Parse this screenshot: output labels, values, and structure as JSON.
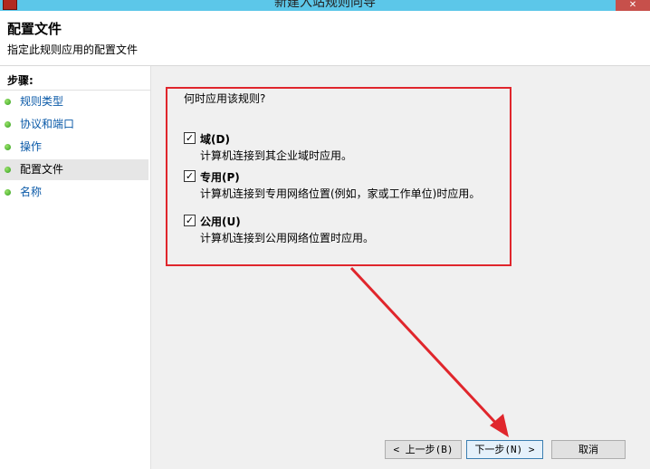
{
  "window": {
    "title": "新建入站规则向导",
    "close_label": "✕"
  },
  "header": {
    "title": "配置文件",
    "subtitle": "指定此规则应用的配置文件"
  },
  "steps": {
    "title": "步骤:",
    "items": [
      {
        "label": "规则类型",
        "current": false
      },
      {
        "label": "协议和端口",
        "current": false
      },
      {
        "label": "操作",
        "current": false
      },
      {
        "label": "配置文件",
        "current": true
      },
      {
        "label": "名称",
        "current": false
      }
    ]
  },
  "main": {
    "question": "何时应用该规则?",
    "options": [
      {
        "label": "域(D)",
        "description": "计算机连接到其企业域时应用。",
        "checked": true
      },
      {
        "label": "专用(P)",
        "description": "计算机连接到专用网络位置(例如，家或工作单位)时应用。",
        "checked": true
      },
      {
        "label": "公用(U)",
        "description": "计算机连接到公用网络位置时应用。",
        "checked": true
      }
    ]
  },
  "buttons": {
    "back": "< 上一步(B)",
    "next": "下一步(N) >",
    "cancel": "取消"
  },
  "colors": {
    "titlebar": "#5cc7e9",
    "annotation_red": "#e0262c",
    "link_blue": "#0b5aa8"
  }
}
